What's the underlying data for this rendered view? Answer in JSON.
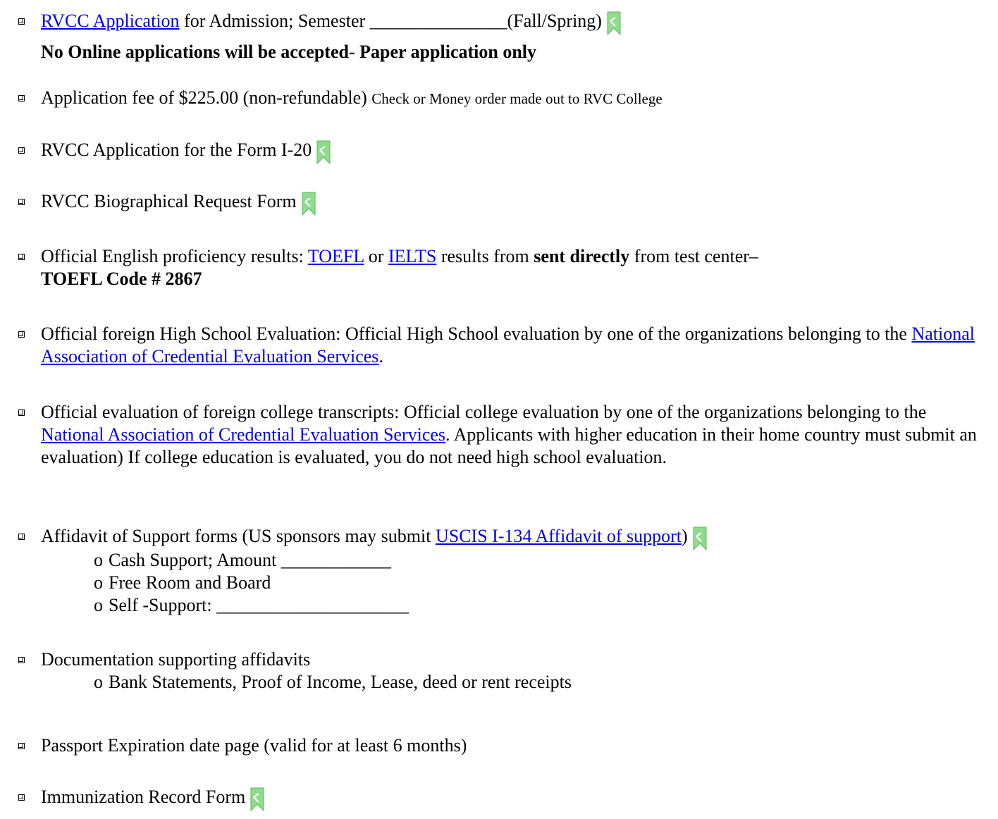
{
  "checklist": {
    "item1": {
      "link": "RVCC Application",
      "text": " for Admission; Semester _______________(Fall/Spring)",
      "note": "No Online applications will be accepted- Paper application only"
    },
    "item2": {
      "text": "Application fee of $225.00 (non-refundable) ",
      "small": "Check or Money order made out to RVC College"
    },
    "item3": {
      "text": "RVCC Application for the Form I-20"
    },
    "item4": {
      "text": "RVCC Biographical Request Form"
    },
    "item5": {
      "text_a": "Official English proficiency results: ",
      "link_toefl": "TOEFL",
      "text_b": " or ",
      "link_ielts": "IELTS",
      "text_c": " results from ",
      "bold_a": "sent directly",
      "text_d": " from test center–",
      "bold_b": "TOEFL Code # 2867"
    },
    "item6": {
      "text_a": "Official foreign High School Evaluation: Official High School evaluation by one of the organizations belonging to the ",
      "link": "National Association of Credential Evaluation Services",
      "text_b": "."
    },
    "item7": {
      "text_a": "Official evaluation of foreign college transcripts: Official college evaluation by one of the organizations belonging to the ",
      "link": "National Association of Credential Evaluation Services",
      "text_b": ". Applicants with higher education in their home country must submit an evaluation) If college education is evaluated, you do not need high school evaluation."
    },
    "item8": {
      "text_a": "Affidavit of Support forms (US sponsors may submit ",
      "link": "USCIS I-134 Affidavit of support",
      "text_b": ")",
      "subs": [
        "Cash Support; Amount ____________",
        "Free Room and Board",
        "Self -Support: _____________________"
      ]
    },
    "item9": {
      "text": "Documentation supporting affidavits",
      "subs": [
        "Bank Statements, Proof of Income, Lease, deed or rent receipts"
      ]
    },
    "item10": {
      "text": "Passport Expiration date page (valid for at least 6 months)"
    },
    "item11": {
      "text": "Immunization Record Form"
    }
  },
  "sub_bullet": "o",
  "icons": {
    "checkbox": "checkbox-icon",
    "bookmark": "bookmark-icon"
  },
  "colors": {
    "link": "#0000ee",
    "bookmark": "#7ed37e"
  }
}
